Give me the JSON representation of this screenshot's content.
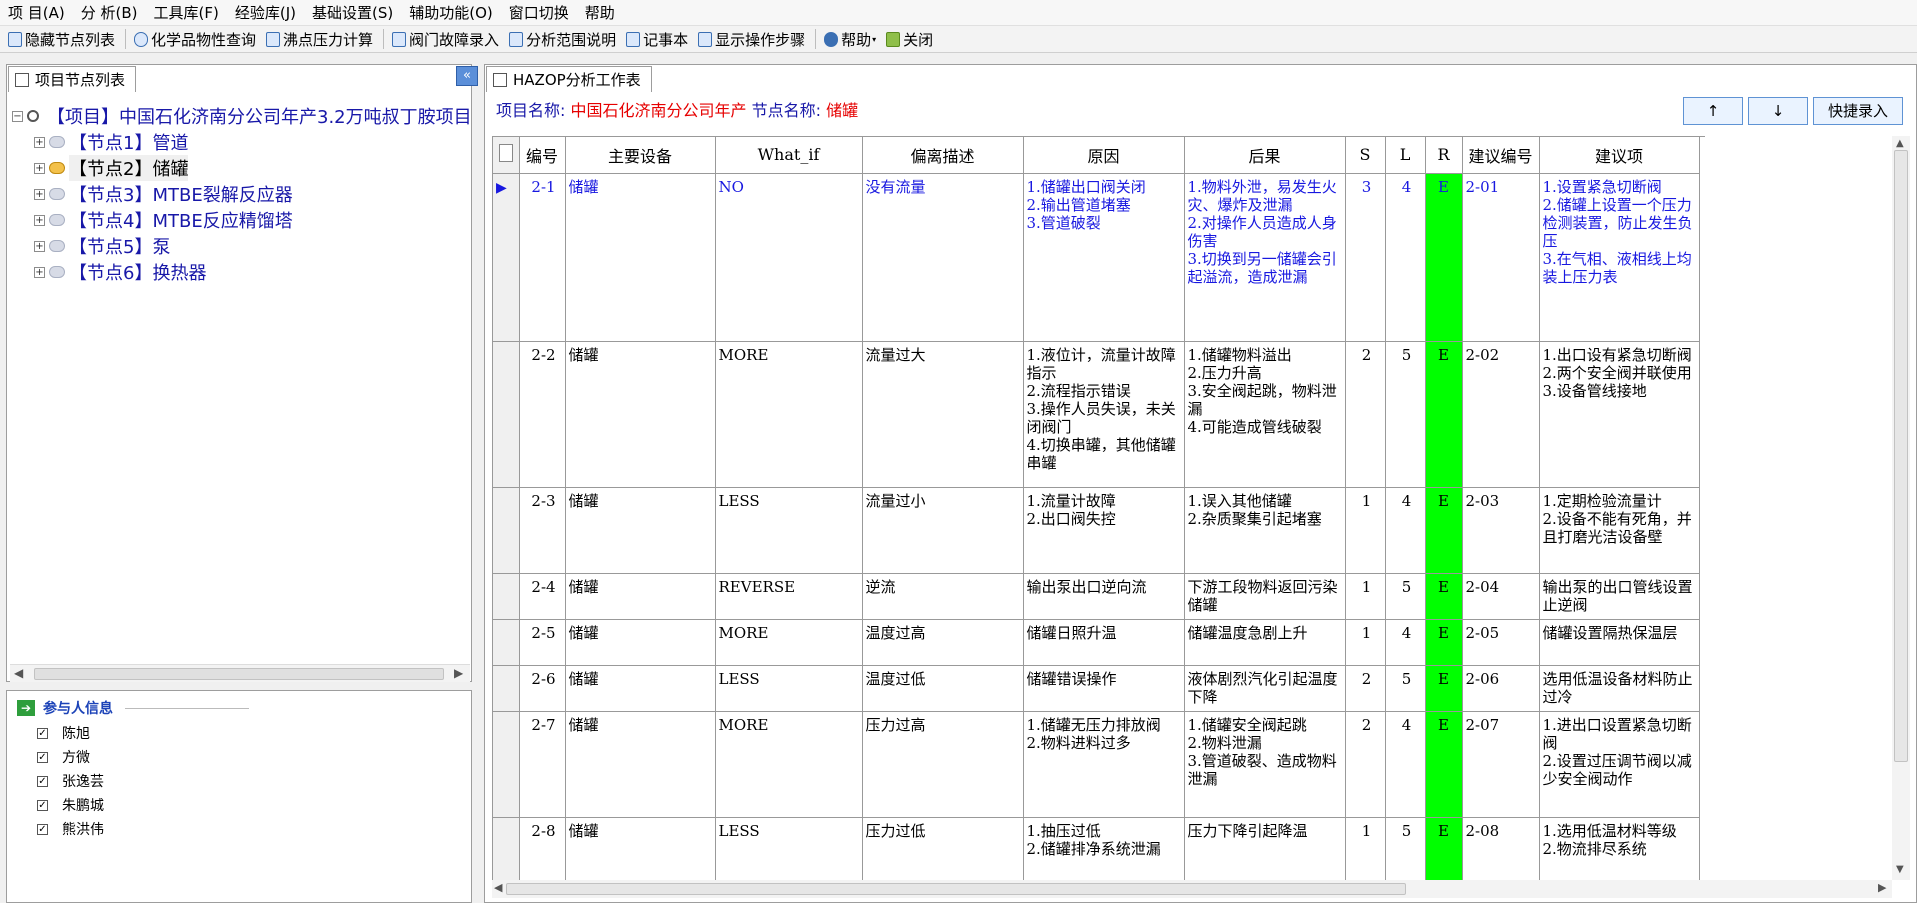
{
  "menu": [
    "项 目(A)",
    "分 析(B)",
    "工具库(F)",
    "经验库(J)",
    "基础设置(S)",
    "辅助功能(O)",
    "窗口切换",
    "帮助"
  ],
  "toolbar": [
    "隐藏节点列表",
    "化学品物性查询",
    "沸点压力计算",
    "阀门故障录入",
    "分析范围说明",
    "记事本",
    "显示操作步骤",
    "帮助",
    "关闭"
  ],
  "left_panel": {
    "tab": "项目节点列表",
    "tree": {
      "project": "【项目】中国石化济南分公司年产3.2万吨叔丁胺项目",
      "nodes": [
        "【节点1】管道",
        "【节点2】储罐",
        "【节点3】MTBE裂解反应器",
        "【节点4】MTBE反应精馏塔",
        "【节点5】泵",
        "【节点6】换热器"
      ]
    }
  },
  "participants": {
    "title": "参与人信息",
    "names": [
      "陈旭",
      "方微",
      "张逸芸",
      "朱鹏城",
      "熊洪伟"
    ]
  },
  "right_panel": {
    "tab": "HAZOP分析工作表",
    "project_label": "项目名称:",
    "project_value": "中国石化济南分公司年产",
    "node_label": "节点名称:",
    "node_value": "储罐",
    "btn_up": "↑",
    "btn_down": "↓",
    "btn_quick": "快捷录入"
  },
  "table": {
    "headers": [
      "编号",
      "主要设备",
      "What_if",
      "偏离描述",
      "原因",
      "后果",
      "S",
      "L",
      "R",
      "建议编号",
      "建议项"
    ],
    "rows": [
      {
        "id": "2-1",
        "equip": "储罐",
        "whatif": "NO",
        "dev": "没有流量",
        "cause": "1.储罐出口阀关闭\n2.输出管道堵塞\n3.管道破裂",
        "conseq": "1.物料外泄，易发生火灾、爆炸及泄漏\n2.对操作人员造成人身伤害\n3.切换到另一储罐会引起溢流，造成泄漏",
        "s": "3",
        "l": "4",
        "r": "E",
        "sid": "2-01",
        "sug": "1.设置紧急切断阀\n2.储罐上设置一个压力检测装置，防止发生负压\n3.在气相、液相线上均装上压力表"
      },
      {
        "id": "2-2",
        "equip": "储罐",
        "whatif": "MORE",
        "dev": "流量过大",
        "cause": "1.液位计，流量计故障指示\n2.流程指示错误\n3.操作人员失误，未关闭阀门\n4.切换串罐，其他储罐串罐",
        "conseq": "1.储罐物料溢出\n2.压力升高\n3.安全阀起跳，物料泄漏\n4.可能造成管线破裂",
        "s": "2",
        "l": "5",
        "r": "E",
        "sid": "2-02",
        "sug": "1.出口设有紧急切断阀\n2.两个安全阀并联使用\n3.设备管线接地"
      },
      {
        "id": "2-3",
        "equip": "储罐",
        "whatif": "LESS",
        "dev": "流量过小",
        "cause": "1.流量计故障\n2.出口阀失控",
        "conseq": "1.误入其他储罐\n2.杂质聚集引起堵塞",
        "s": "1",
        "l": "4",
        "r": "E",
        "sid": "2-03",
        "sug": "1.定期检验流量计\n2.设备不能有死角，并且打磨光洁设备壁"
      },
      {
        "id": "2-4",
        "equip": "储罐",
        "whatif": "REVERSE",
        "dev": "逆流",
        "cause": "输出泵出口逆向流",
        "conseq": "下游工段物料返回污染储罐",
        "s": "1",
        "l": "5",
        "r": "E",
        "sid": "2-04",
        "sug": "输出泵的出口管线设置止逆阀"
      },
      {
        "id": "2-5",
        "equip": "储罐",
        "whatif": "MORE",
        "dev": "温度过高",
        "cause": "储罐日照升温",
        "conseq": "储罐温度急剧上升",
        "s": "1",
        "l": "4",
        "r": "E",
        "sid": "2-05",
        "sug": "储罐设置隔热保温层"
      },
      {
        "id": "2-6",
        "equip": "储罐",
        "whatif": "LESS",
        "dev": "温度过低",
        "cause": "储罐错误操作",
        "conseq": "液体剧烈汽化引起温度下降",
        "s": "2",
        "l": "5",
        "r": "E",
        "sid": "2-06",
        "sug": "选用低温设备材料防止过冷"
      },
      {
        "id": "2-7",
        "equip": "储罐",
        "whatif": "MORE",
        "dev": "压力过高",
        "cause": "1.储罐无压力排放阀\n2.物料进料过多",
        "conseq": "1.储罐安全阀起跳\n2.物料泄漏\n3.管道破裂、造成物料泄漏",
        "s": "2",
        "l": "4",
        "r": "E",
        "sid": "2-07",
        "sug": "1.进出口设置紧急切断阀\n2.设置过压调节阀以减少安全阀动作"
      },
      {
        "id": "2-8",
        "equip": "储罐",
        "whatif": "LESS",
        "dev": "压力过低",
        "cause": "1.抽压过低\n2.储罐排净系统泄漏",
        "conseq": "压力下降引起降温",
        "s": "1",
        "l": "5",
        "r": "E",
        "sid": "2-08",
        "sug": "1.选用低温材料等级\n2.物流排尽系统"
      }
    ]
  },
  "colors": {
    "accent_blue": "#1818a8",
    "red": "#e60000",
    "risk_green": "#00ff00"
  }
}
